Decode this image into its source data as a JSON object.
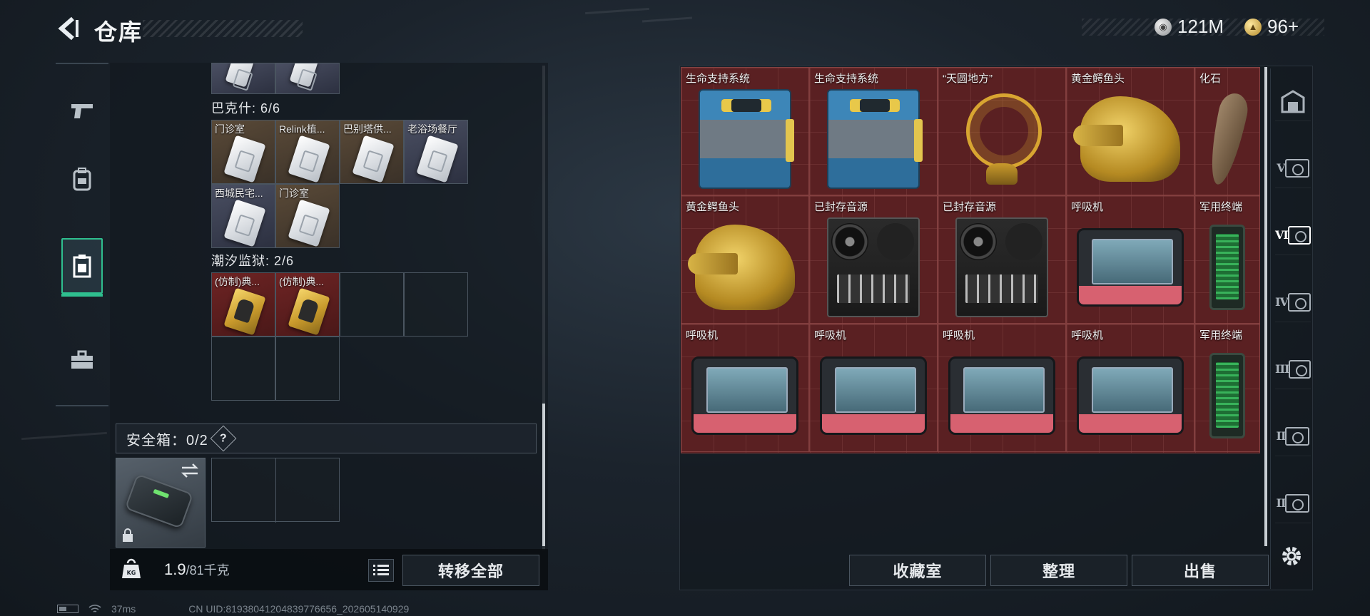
{
  "header": {
    "title": "仓库",
    "currency_silver": "121M",
    "currency_gold": "96+"
  },
  "left_rail": [
    "pistol-icon",
    "backpack-icon",
    "clipboard-icon",
    "briefcase-icon"
  ],
  "stash": {
    "sections": [
      {
        "label": "巴克什: 6/6"
      },
      {
        "label": "潮汐监狱: 2/6"
      }
    ],
    "bakeshi_cells": [
      "门诊室",
      "Relink植...",
      "巴别塔供...",
      "老浴场餐厅",
      "西城民宅...",
      "门诊室"
    ],
    "tide_cells": [
      "(仿制)典...",
      "(仿制)典..."
    ]
  },
  "safe_box": {
    "label": "安全箱：0/2",
    "help": "?"
  },
  "weight": {
    "current": "1.9",
    "max": "/81千克"
  },
  "transfer_all": "转移全部",
  "status": {
    "ping": "37ms",
    "uid": "CN UID:8193804120483977665​6_202605140929"
  },
  "items": [
    {
      "label": "生命支持系统",
      "art": "lifesupport"
    },
    {
      "label": "生命支持系统",
      "art": "lifesupport"
    },
    {
      "label": "“天圆地方”",
      "art": "armillary"
    },
    {
      "label": "黄金鳄鱼头",
      "art": "croc"
    },
    {
      "label": "化石",
      "art": "fossil"
    },
    {
      "label": "黄金鳄鱼头",
      "art": "croc"
    },
    {
      "label": "已封存音源",
      "art": "reel"
    },
    {
      "label": "已封存音源",
      "art": "reel"
    },
    {
      "label": "呼吸机",
      "art": "vent"
    },
    {
      "label": "军用终端",
      "art": "terminal"
    },
    {
      "label": "呼吸机",
      "art": "vent"
    },
    {
      "label": "呼吸机",
      "art": "vent"
    },
    {
      "label": "呼吸机",
      "art": "vent"
    },
    {
      "label": "呼吸机",
      "art": "vent"
    },
    {
      "label": "军用终端",
      "art": "terminal"
    }
  ],
  "right_rail": [
    "vault-icon",
    "V",
    "VI",
    "IV",
    "III",
    "II",
    "II"
  ],
  "actions": {
    "collection": "收藏室",
    "sort": "整理",
    "sell": "出售"
  },
  "colors": {
    "accent": "#2fbf8f",
    "grid_red": "#5a2022"
  }
}
